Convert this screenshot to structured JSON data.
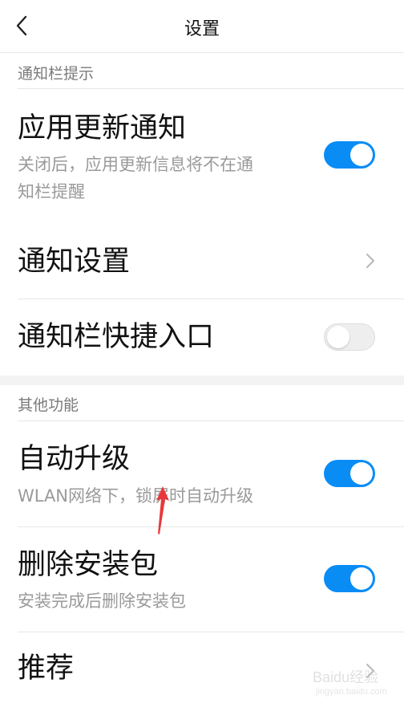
{
  "header": {
    "title": "设置"
  },
  "section_notify": {
    "label": "通知栏提示"
  },
  "app_update": {
    "title": "应用更新通知",
    "sub_line1": "关闭后，应用更新信息将不在通",
    "sub_line2": "知栏提醒",
    "enabled": true
  },
  "notify_settings": {
    "title": "通知设置"
  },
  "quick_entry": {
    "title": "通知栏快捷入口",
    "enabled": false
  },
  "section_other": {
    "label": "其他功能"
  },
  "auto_upgrade": {
    "title": "自动升级",
    "sub": "WLAN网络下，锁屏时自动升级",
    "enabled": true
  },
  "delete_pkg": {
    "title": "删除安装包",
    "sub": "安装完成后删除安装包",
    "enabled": true
  },
  "recommend": {
    "title": "推荐"
  },
  "watermark": {
    "text": "Baidu经验",
    "sub": "jingyan.baidu.com"
  },
  "colors": {
    "accent": "#0a8cf5",
    "annotation": "#e8383b"
  },
  "icons": {
    "back": "back-arrow-icon",
    "chevron": "chevron-right-icon"
  }
}
